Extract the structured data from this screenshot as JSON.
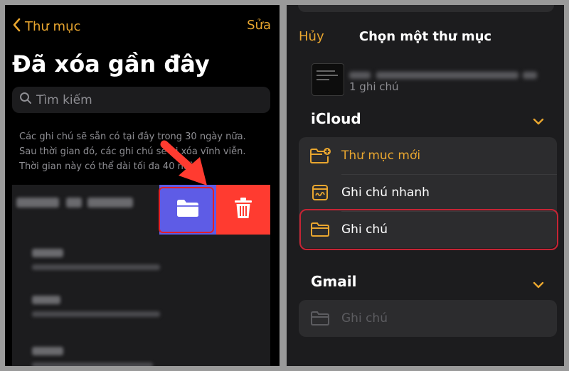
{
  "left": {
    "back_label": "Thư mục",
    "edit_label": "Sửa",
    "title": "Đã xóa gần đây",
    "search_placeholder": "Tìm kiếm",
    "info_lines": [
      "Các ghi chú sẽ sẵn có tại đây trong 30 ngày nữa.",
      "Sau thời gian đó, các ghi chú sẽ bị xóa vĩnh viễn.",
      "Thời gian này có thể dài tối đa 40 ngày."
    ],
    "icons": {
      "back": "chevron-left-icon",
      "search": "search-icon",
      "move": "folder-icon",
      "delete": "trash-icon",
      "annotation": "red-arrow"
    }
  },
  "right": {
    "cancel_label": "Hủy",
    "title": "Chọn một thư mục",
    "recent_note_count": "1 ghi chú",
    "icloud_section": "iCloud",
    "icloud_items": [
      {
        "label": "Thư mục mới",
        "icon": "new-folder-icon"
      },
      {
        "label": "Ghi chú nhanh",
        "icon": "quick-note-icon"
      },
      {
        "label": "Ghi chú",
        "icon": "folder-icon"
      }
    ],
    "gmail_section": "Gmail",
    "gmail_items": [
      {
        "label": "Ghi chú",
        "icon": "folder-icon"
      }
    ]
  },
  "colors": {
    "accent": "#e9a62f",
    "move_button": "#5e5ce6",
    "delete_button": "#ff3b30",
    "highlight": "#c62434"
  }
}
